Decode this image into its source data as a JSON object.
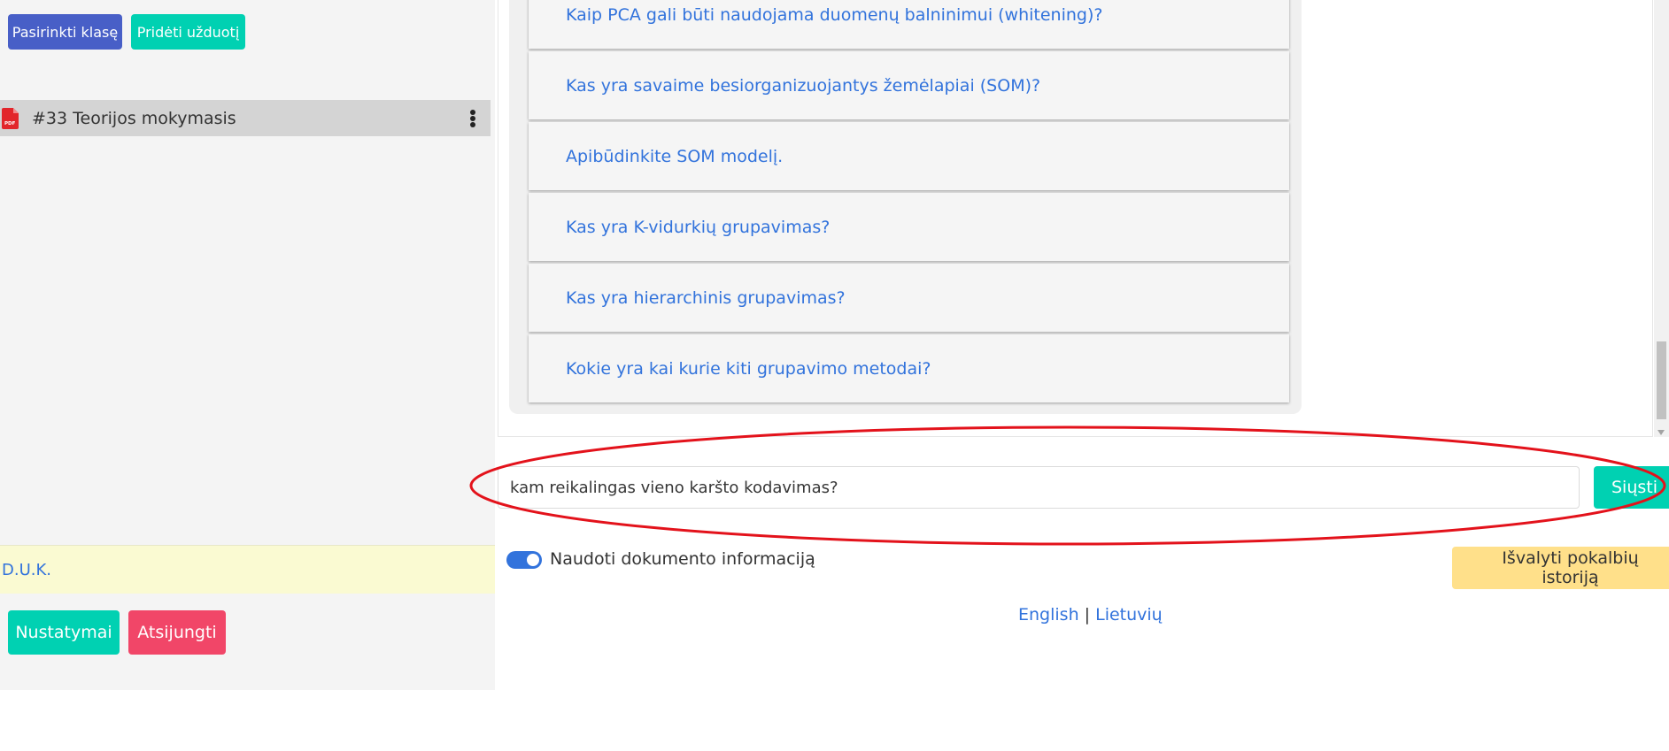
{
  "sidebar": {
    "select_class_label": "Pasirinkti klasę",
    "add_task_label": "Pridėti užduotį",
    "task_item": {
      "label": "#33 Teorijos mokymasis",
      "icon": "pdf-file-icon",
      "icon_text": "PDF"
    },
    "faq_label": "D.U.K.",
    "settings_label": "Nustatymai",
    "logout_label": "Atsijungti"
  },
  "chat": {
    "questions": [
      "Kaip PCA gali būti naudojama duomenų balninimui (whitening)?",
      "Kas yra savaime besiorganizuojantys žemėlapiai (SOM)?",
      "Apibūdinkite SOM modelį.",
      "Kas yra K-vidurkių grupavimas?",
      "Kas yra hierarchinis grupavimas?",
      "Kokie yra kai kurie kiti grupavimo metodai?"
    ],
    "input_value": "kam reikalingas vieno karšto kodavimas?",
    "send_label": "Siųsti",
    "use_document_label": "Naudoti dokumento informaciją",
    "use_document_enabled": true,
    "clear_history_label": "Išvalyti pokalbių istoriją"
  },
  "language": {
    "english": "English",
    "separator": "|",
    "lithuanian": "Lietuvių"
  },
  "colors": {
    "primary": "#485fc7",
    "teal": "#00d1b2",
    "danger": "#f14668",
    "link": "#3273dc",
    "warning": "#ffe08a",
    "annotation": "#e3121b"
  }
}
